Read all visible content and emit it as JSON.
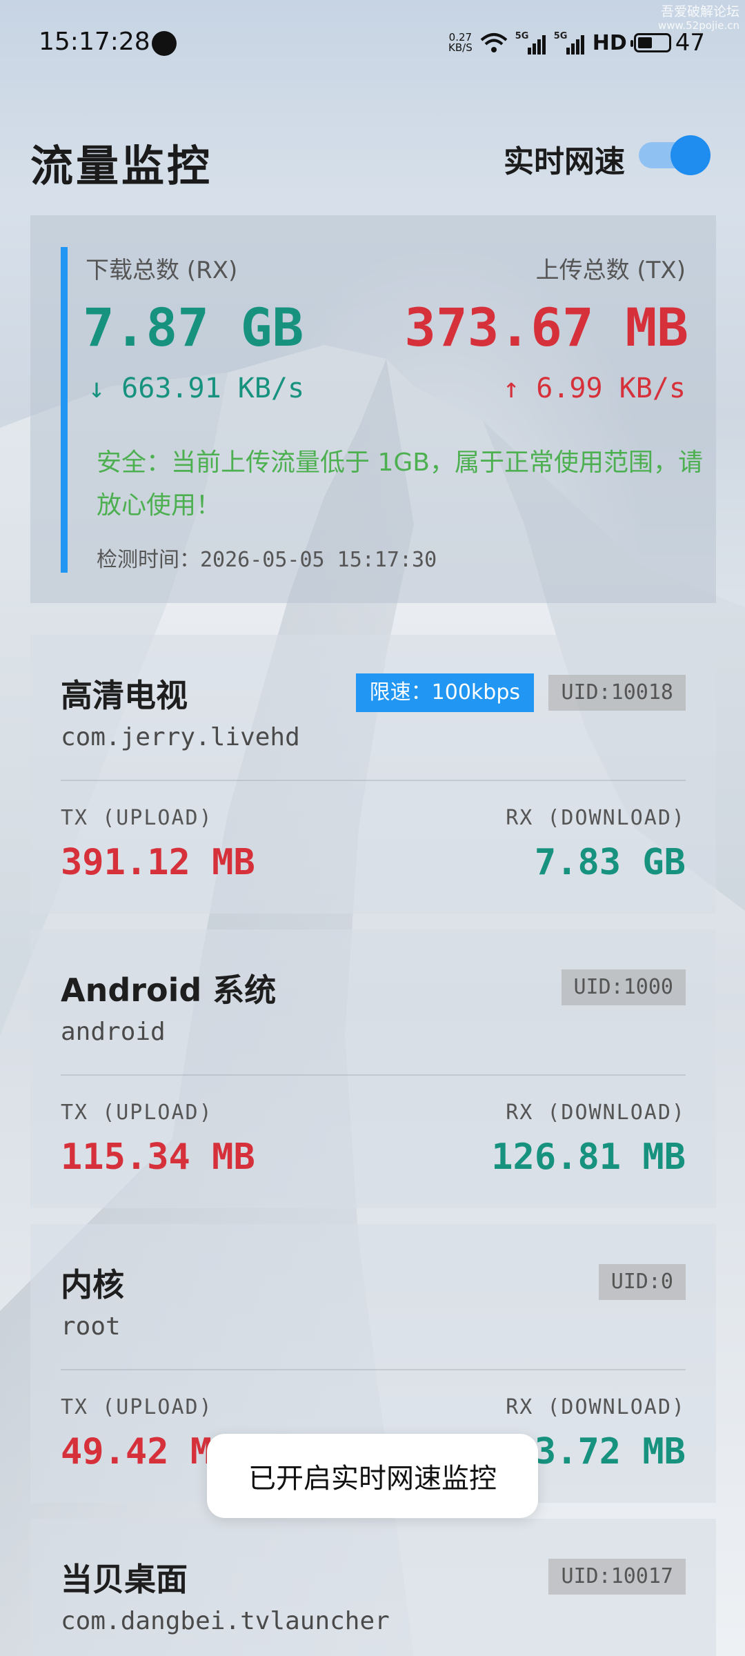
{
  "watermark": {
    "line1": "吾爱破解论坛",
    "line2": "www.52pojie.cn"
  },
  "status_bar": {
    "time": "15:17:28",
    "net_speed_value": "0.27",
    "net_speed_unit": "KB/S",
    "signal1_label": "5G",
    "signal2_label": "5G",
    "hd_label": "HD",
    "battery": "47"
  },
  "header": {
    "title": "流量监控",
    "realtime_label": "实时网速",
    "realtime_enabled": true
  },
  "summary": {
    "rx_label": "下载总数 (RX)",
    "tx_label": "上传总数 (TX)",
    "rx_total": "7.87 GB",
    "tx_total": "373.67 MB",
    "rx_speed": "↓ 663.91 KB/s",
    "tx_speed": "↑ 6.99 KB/s",
    "safety_message": "安全：当前上传流量低于 1GB，属于正常使用范围，请放心使用！",
    "check_time": "检测时间：2026-05-05 15:17:30",
    "accent_color": "#2196f3",
    "rx_color": "#16927f",
    "tx_color": "#d6313b",
    "safe_color": "#4caf50"
  },
  "apps": [
    {
      "name": "高清电视",
      "package": "com.jerry.livehd",
      "limit": "限速：100kbps",
      "uid": "UID:10018",
      "tx_label": "TX (UPLOAD)",
      "rx_label": "RX (DOWNLOAD)",
      "tx": "391.12 MB",
      "rx": "7.83 GB"
    },
    {
      "name": "Android 系统",
      "package": "android",
      "uid": "UID:1000",
      "tx_label": "TX (UPLOAD)",
      "rx_label": "RX (DOWNLOAD)",
      "tx": "115.34 MB",
      "rx": "126.81 MB"
    },
    {
      "name": "内核",
      "package": "root",
      "uid": "UID:0",
      "tx_label": "TX (UPLOAD)",
      "rx_label": "RX (DOWNLOAD)",
      "tx": "49.42 MB",
      "rx": "3.72 MB"
    },
    {
      "name": "当贝桌面",
      "package": "com.dangbei.tvlauncher",
      "uid": "UID:10017"
    }
  ],
  "toast": "已开启实时网速监控"
}
